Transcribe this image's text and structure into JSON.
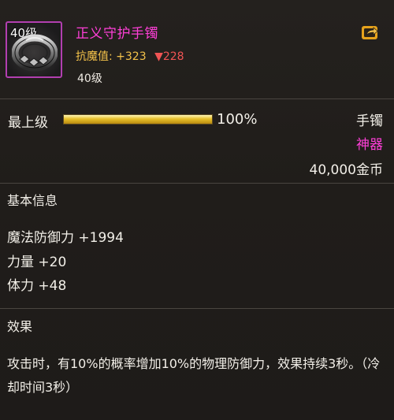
{
  "item": {
    "name": "正义守护手镯",
    "level_badge": "40级",
    "resist_label": "抗魔值:",
    "resist_value": "+323",
    "resist_change": "▼228",
    "required_level": "40级",
    "icon": "bracelet-icon"
  },
  "upgrade": {
    "label": "最上级",
    "progress_percent": 100,
    "progress_text": "100%"
  },
  "meta": {
    "type": "手镯",
    "rarity": "神器",
    "price": "40,000金币"
  },
  "basic_info": {
    "title": "基本信息",
    "stats": [
      "魔法防御力 +1994",
      "力量 +20",
      "体力 +48"
    ]
  },
  "effect": {
    "title": "效果",
    "text": "攻击时，有10%的概率增加10%的物理防御力，效果持续3秒。（冷却时间3秒）"
  },
  "colors": {
    "rarity": "#ff3fd8",
    "resist": "#f4c24a",
    "decrease": "#f05454",
    "icon_border": "#b23fb0"
  }
}
